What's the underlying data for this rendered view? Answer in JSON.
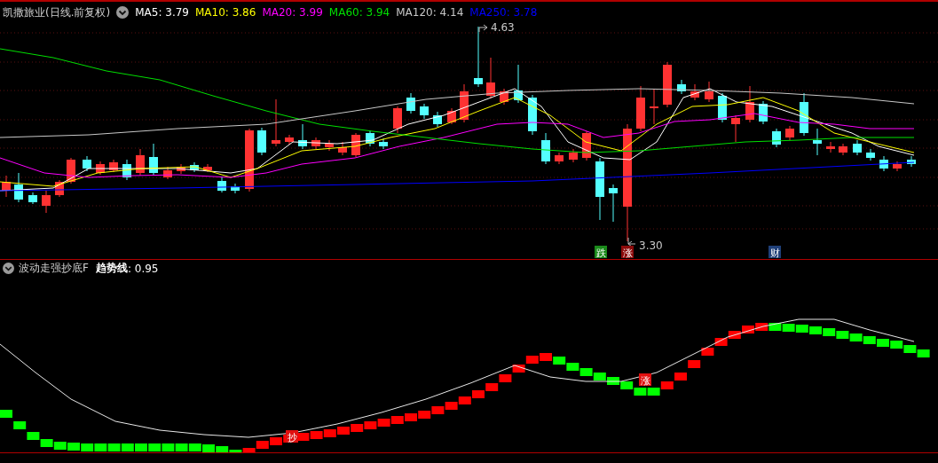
{
  "title": "凯撒旅业(日线.前复权)",
  "ma_legend": [
    {
      "label": "MA5: 3.79",
      "color": "#ffffff"
    },
    {
      "label": "MA10: 3.86",
      "color": "#ffff00"
    },
    {
      "label": "MA20: 3.99",
      "color": "#ff00ff"
    },
    {
      "label": "MA60: 3.94",
      "color": "#00e000"
    },
    {
      "label": "MA120: 4.14",
      "color": "#c8c8c8"
    },
    {
      "label": "MA250: 3.78",
      "color": "#0000ff"
    }
  ],
  "price_chart": {
    "high_label": "4.63",
    "low_label": "3.30",
    "signals": [
      {
        "text": "跌",
        "color": "#1a8a1a"
      },
      {
        "text": "涨",
        "color": "#8b0a0a"
      },
      {
        "text": "财",
        "color": "#1f3f78"
      }
    ]
  },
  "indicator": {
    "name": "波动走强抄底F",
    "line_label": "趋势线",
    "line_value": ": 0.95",
    "signals": [
      {
        "text": "抄",
        "color": "#e01010"
      },
      {
        "text": "涨",
        "color": "#e01010"
      }
    ]
  }
}
